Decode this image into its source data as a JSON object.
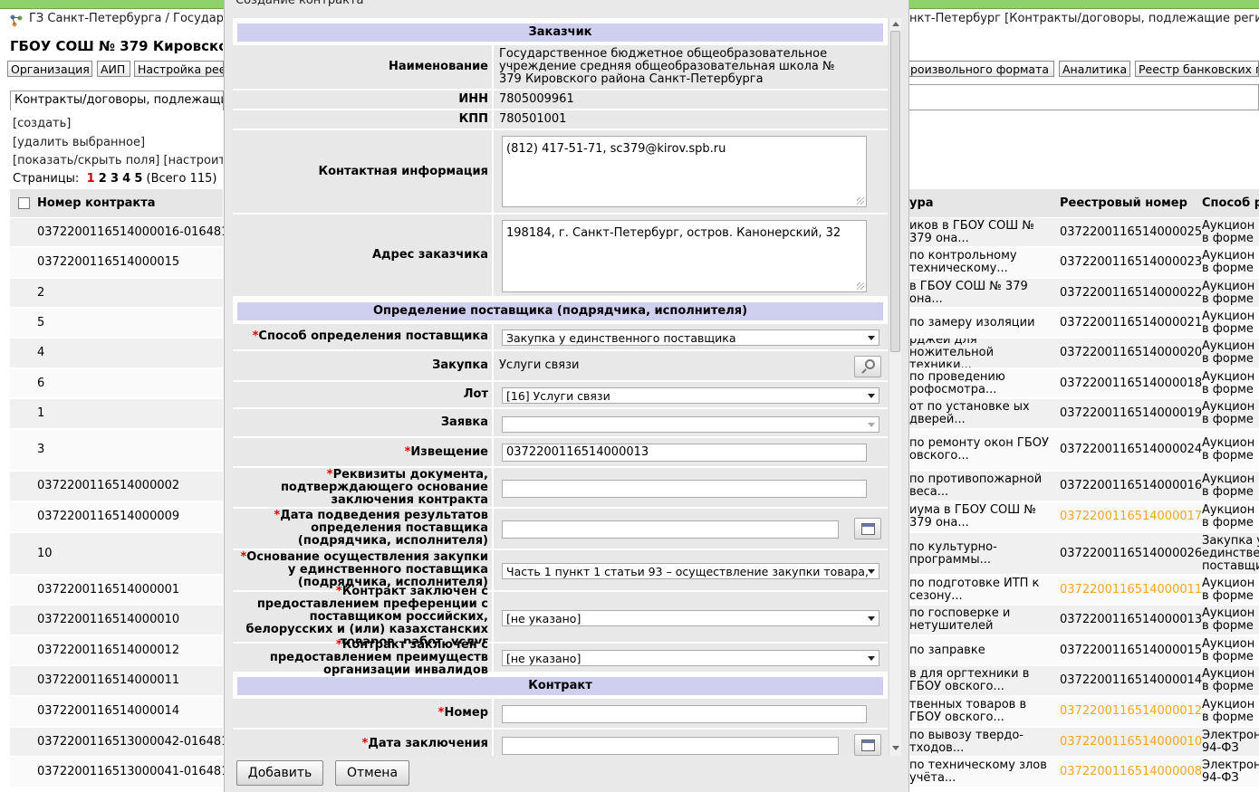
{
  "header": {
    "breadcrumb_left": "ГЗ Санкт-Петербурга / Государст",
    "breadcrumb_right": "нкт-Петербург [Контракты/договоры, подлежащие регис",
    "org_title": "ГБОУ СОШ № 379 Кировско"
  },
  "menu": {
    "left": [
      "Организация",
      "АИП",
      "Настройка рее"
    ],
    "right": [
      "роизвольного формата",
      "Аналитика",
      "Реестр банковских г"
    ]
  },
  "tab": {
    "label": "Контракты/договоры, подлежащие"
  },
  "actions": {
    "create": "[создать]",
    "delete": "[удалить выбранное]",
    "showhide": "[показать/скрыть поля] [настроить"
  },
  "pages": {
    "label": "Страницы:",
    "items": [
      "1",
      "2",
      "3",
      "4",
      "5"
    ],
    "total": "(Всего 115)"
  },
  "table": {
    "col_number": "Номер контракта",
    "col_subject": "ура",
    "col_registry": "Реестровый номер",
    "col_method": "Способ ра",
    "rows": [
      {
        "num": "0372200116514000016-016481",
        "subject": "иков в ГБОУ СОШ № 379 она...",
        "reg": "0372200116514000025",
        "method": "Аукцион в форме",
        "orange": false
      },
      {
        "num": "0372200116514000015",
        "subject": "по контрольному техническому...",
        "reg": "0372200116514000023",
        "method": "Аукцион в форме",
        "orange": false
      },
      {
        "num": "2",
        "subject": "в ГБОУ СОШ № 379 она...",
        "reg": "0372200116514000022",
        "method": "Аукцион в форме",
        "orange": false
      },
      {
        "num": "5",
        "subject": "по замеру изоляции",
        "reg": "0372200116514000021",
        "method": "Аукцион в форме",
        "orange": false
      },
      {
        "num": "4",
        "subject": "рджей для ножительной техники...",
        "reg": "0372200116514000020",
        "method": "Аукцион в форме",
        "orange": false
      },
      {
        "num": "6",
        "subject": "по проведению рофосмотра...",
        "reg": "0372200116514000018",
        "method": "Аукцион в форме",
        "orange": false
      },
      {
        "num": "1",
        "subject": "от по установке ых дверей...",
        "reg": "0372200116514000019",
        "method": "Аукцион в форме",
        "orange": false
      },
      {
        "num": "3",
        "subject": "по ремонту окон ГБОУ овского...",
        "reg": "0372200116514000024",
        "method": "Аукцион в форме",
        "orange": false
      },
      {
        "num": "0372200116514000002",
        "subject": "по противопожарной веса...",
        "reg": "0372200116514000016",
        "method": "Аукцион в форме",
        "orange": false
      },
      {
        "num": "0372200116514000009",
        "subject": "иума в ГБОУ СОШ № 379 она...",
        "reg": "0372200116514000017",
        "method": "Аукцион в форме",
        "orange": true
      },
      {
        "num": "10",
        "subject": "по культурно-программы...",
        "reg": "0372200116514000026",
        "method": "Закупка у единствен поставщи",
        "orange": false
      },
      {
        "num": "0372200116514000001",
        "subject": "по подготовке ИТП к сезону...",
        "reg": "0372200116514000011",
        "method": "Аукцион в форме",
        "orange": true
      },
      {
        "num": "0372200116514000010",
        "subject": "по госповерке и нетушителей",
        "reg": "0372200116514000013",
        "method": "Аукцион в форме",
        "orange": false
      },
      {
        "num": "0372200116514000012",
        "subject": "по заправке",
        "reg": "0372200116514000015",
        "method": "Аукцион в форме",
        "orange": false
      },
      {
        "num": "0372200116514000011",
        "subject": "в для оргтехники в ГБОУ овского...",
        "reg": "0372200116514000014",
        "method": "Аукцион в форме",
        "orange": false
      },
      {
        "num": "0372200116514000014",
        "subject": "твенных товаров в ГБОУ овского...",
        "reg": "0372200116514000012",
        "method": "Аукцион в форме",
        "orange": true
      },
      {
        "num": "0372200116513000042-016481",
        "subject": "по вывозу твердо-тходов...",
        "reg": "0372200116514000010",
        "method": "Электрон 94-ФЗ",
        "orange": true
      },
      {
        "num": "0372200116513000041-016481",
        "subject": "по техническому злов учёта...",
        "reg": "0372200116514000008",
        "method": "Электрон 94-ФЗ",
        "orange": true
      }
    ]
  },
  "modal": {
    "title": "Создание контракта",
    "sections": {
      "customer": "Заказчик",
      "supplier": "Определение поставщика (подрядчика, исполнителя)",
      "contract": "Контракт"
    },
    "fields": {
      "name_label": "Наименование",
      "name_value": "Государственное бюджетное общеобразовательное учреждение средняя общеобразовательная школа № 379 Кировского района Санкт-Петербурга",
      "inn_label": "ИНН",
      "inn_value": "7805009961",
      "kpp_label": "КПП",
      "kpp_value": "780501001",
      "contact_label": "Контактная информация",
      "contact_value": "(812) 417-51-71, sc379@kirov.spb.ru",
      "address_label": "Адрес заказчика",
      "address_value": "198184, г. Санкт-Петербург, остров. Канонерский, 32",
      "method_label": "Способ определения поставщика",
      "method_value": "Закупка у единственного поставщика",
      "purchase_label": "Закупка",
      "purchase_value": "Услуги связи",
      "lot_label": "Лот",
      "lot_value": "[16] Услуги связи",
      "bid_label": "Заявка",
      "bid_value": "",
      "notice_label": "Извещение",
      "notice_value": "0372200116514000013",
      "doc_label": "Реквизиты документа, подтверждающего основание заключения контракта",
      "doc_value": "",
      "date_result_label": "Дата подведения результатов определения поставщика (подрядчика, исполнителя)",
      "date_result_value": "",
      "basis_label": "Основание осуществления закупки у единственного поставщика (подрядчика, исполнителя)",
      "basis_value": "Часть 1 пункт 1 статьи 93 – осуществление закупки товара,",
      "pref_label": "Контракт заключен с предоставлением преференции с поставщиком российских, белорусских и (или) казахстанских товаров, работ, услуг",
      "pref_value": "[не указано]",
      "invalid_label": "Контракт заключен с предоставлением преимуществ организации инвалидов",
      "invalid_value": "[не указано]",
      "number_label": "Номер",
      "number_value": "",
      "date_label": "Дата заключения",
      "date_value": ""
    },
    "buttons": {
      "add": "Добавить",
      "cancel": "Отмена"
    },
    "required_mark": "*"
  }
}
